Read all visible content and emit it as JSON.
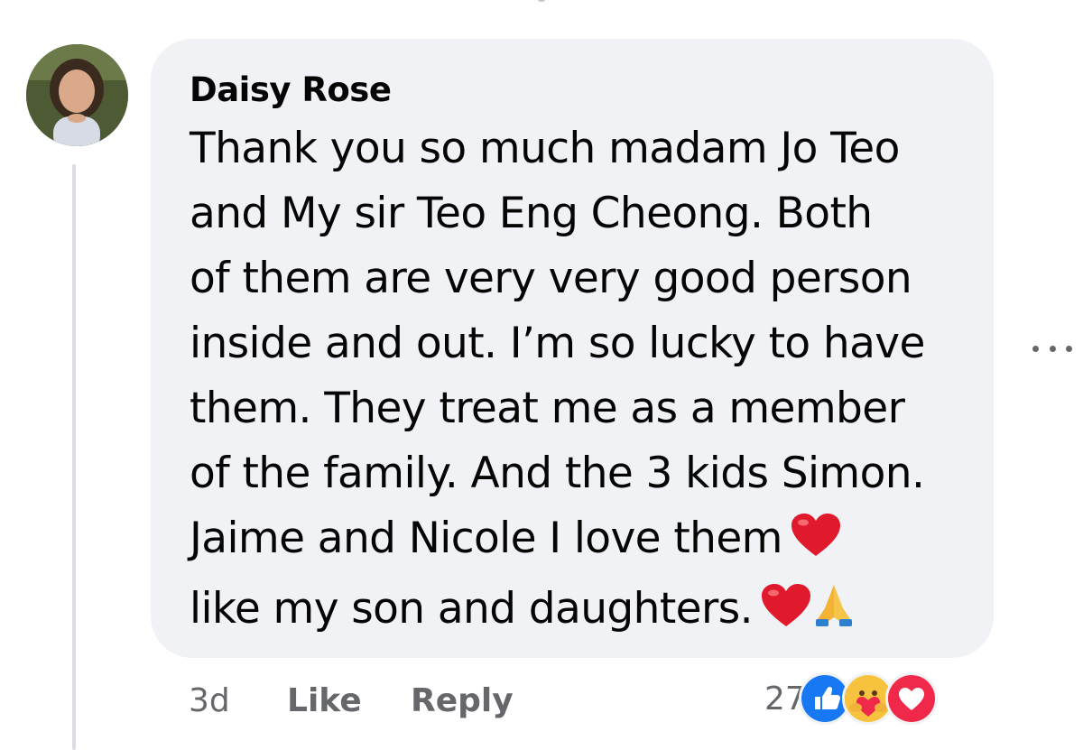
{
  "comment": {
    "author": "Daisy Rose",
    "text_lines": [
      "Thank you so much madam Jo Teo",
      "and My sir Teo Eng Cheong. Both",
      "of them are very very good person",
      "inside and out. I’m so lucky to have",
      "them. They treat me as a member",
      "of the family. And the 3 kids Simon.",
      "Jaime and Nicole I love them",
      "like my son and daughters."
    ],
    "line_emojis": {
      "6": [
        "red-heart"
      ],
      "7": [
        "red-heart",
        "folded-hands"
      ]
    },
    "timestamp": "3d",
    "like_label": "Like",
    "reply_label": "Reply",
    "reaction_count": "27",
    "reaction_icons": [
      "like-reaction",
      "care-reaction",
      "love-reaction"
    ]
  },
  "colors": {
    "bubble": "#f0f2f5",
    "secondary_text": "#65676b",
    "like_blue": "#1877f2",
    "love_red": "#f02849",
    "heart_red": "#e0192c"
  }
}
